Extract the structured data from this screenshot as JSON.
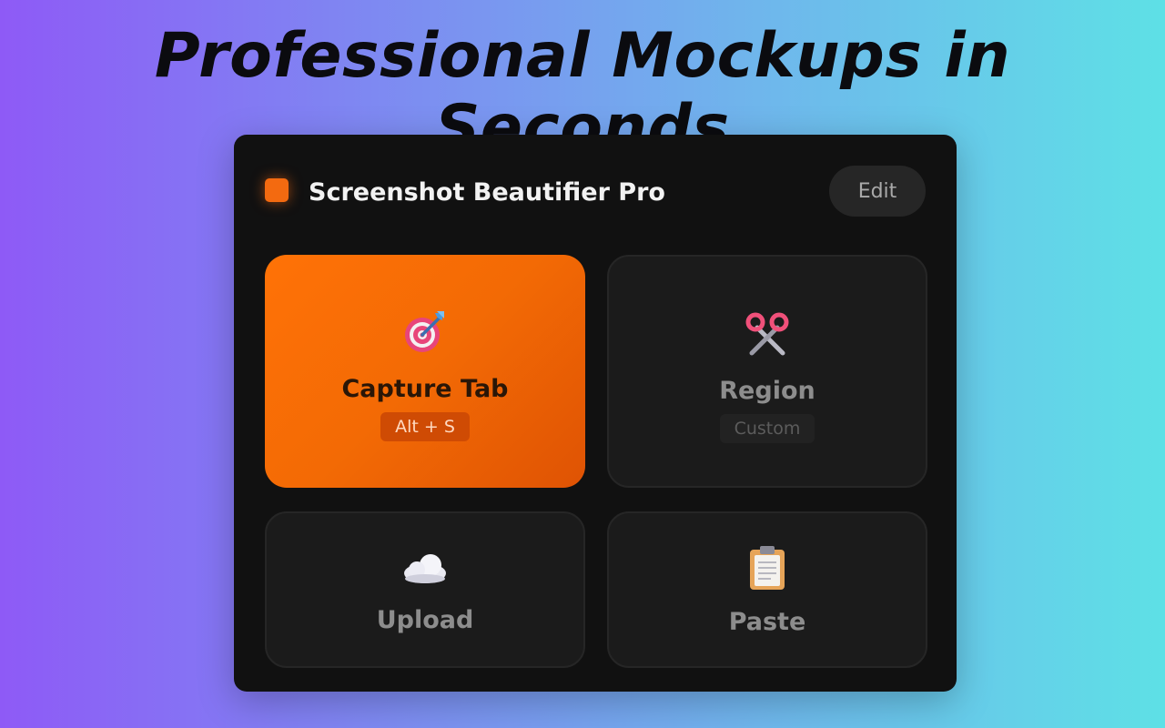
{
  "headline": "Professional Mockups in Seconds",
  "app": {
    "title": "Screenshot Beautifier Pro",
    "edit_label": "Edit",
    "accent_color": "#f36a10"
  },
  "tiles": [
    {
      "label": "Capture Tab",
      "shortcut": "Alt + S",
      "icon": "target-icon",
      "active": true
    },
    {
      "label": "Region",
      "shortcut": "Custom",
      "icon": "scissors-icon",
      "active": false
    },
    {
      "label": "Upload",
      "icon": "cloud-icon",
      "active": false
    },
    {
      "label": "Paste",
      "icon": "clipboard-icon",
      "active": false
    }
  ]
}
